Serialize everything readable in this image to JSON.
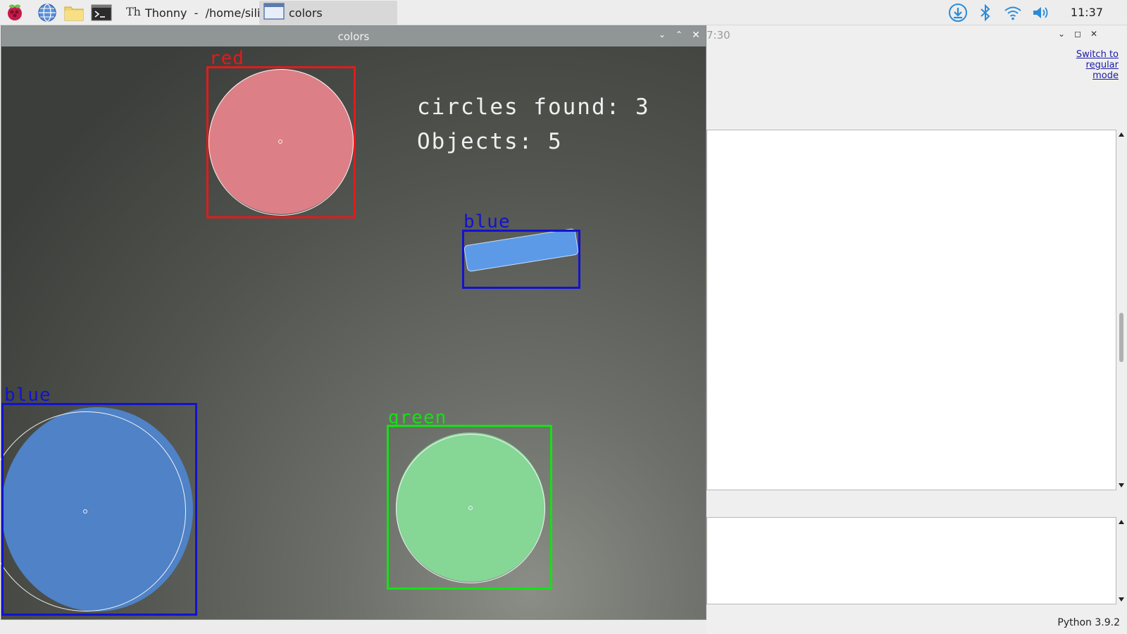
{
  "taskbar": {
    "tasks": [
      {
        "label": "Thonny  -  /home/sili..."
      },
      {
        "label": "colors"
      }
    ],
    "clock": "11:37",
    "icons": [
      "raspberry-menu-icon",
      "browser-icon",
      "file-manager-icon",
      "terminal-icon",
      "download-icon",
      "bluetooth-icon",
      "wifi-icon",
      "volume-icon"
    ]
  },
  "thonny": {
    "title_fragment": "7:30",
    "switch_mode_link": "Switch to regular mode",
    "status": "Python 3.9.2"
  },
  "colors_window": {
    "title": "colors",
    "overlay": {
      "circles_found": "circles found: 3",
      "objects": "Objects: 5"
    },
    "detections": [
      {
        "label": "red",
        "color": "#e21b1b",
        "fill": "#dc7f86"
      },
      {
        "label": "blue",
        "color": "#1212d0",
        "fill": "#4f8ee0"
      },
      {
        "label": "blue",
        "color": "#1212d0",
        "fill": "#4f82c6"
      },
      {
        "label": "green",
        "color": "#16e016",
        "fill": "#86d696"
      }
    ]
  }
}
